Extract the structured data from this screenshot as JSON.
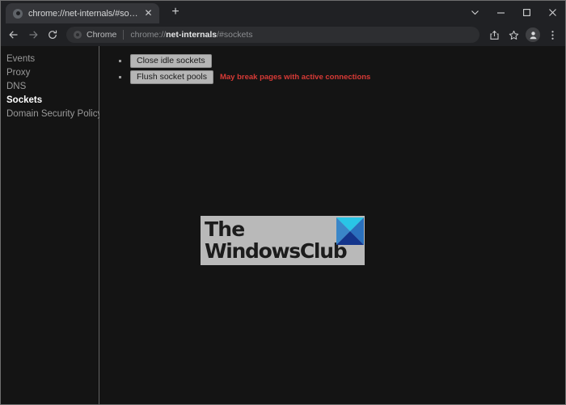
{
  "window": {
    "controls": [
      {
        "name": "tab-search",
        "glyph": "chevron-down"
      },
      {
        "name": "minimize",
        "glyph": "minimize"
      },
      {
        "name": "maximize",
        "glyph": "maximize"
      },
      {
        "name": "close",
        "glyph": "close"
      }
    ]
  },
  "tabstrip": {
    "tab_title": "chrome://net-internals/#sockets",
    "close_label": "✕",
    "new_tab_label": "+"
  },
  "toolbar": {
    "back_label": "Back",
    "forward_label": "Forward",
    "reload_label": "Reload",
    "omnibox": {
      "chip_label": "Chrome",
      "url_scheme": "chrome://",
      "url_host": "net-internals",
      "url_path": "/#sockets"
    },
    "share_label": "Share",
    "bookmark_label": "Bookmark this tab",
    "profile_label": "Profile",
    "menu_label": "Customize and control Google Chrome"
  },
  "sidebar": {
    "items": [
      {
        "label": "Events",
        "active": false
      },
      {
        "label": "Proxy",
        "active": false
      },
      {
        "label": "DNS",
        "active": false
      },
      {
        "label": "Sockets",
        "active": true
      },
      {
        "label": "Domain Security Policy",
        "active": false
      }
    ]
  },
  "main": {
    "actions": [
      {
        "button": "Close idle sockets",
        "warning": ""
      },
      {
        "button": "Flush socket pools",
        "warning": "May break pages with active connections"
      }
    ]
  },
  "watermark": {
    "line1": "The",
    "line2": "WindowsClub",
    "logo_name": "windowsclub-diamond-logo"
  },
  "colors": {
    "chrome_frame": "#202124",
    "tab_active": "#35363a",
    "page_background": "#141414",
    "sidebar_text": "#9a9a9a",
    "active_text": "#ffffff",
    "warning_red": "#d83a36",
    "button_face": "#b5b5b5",
    "watermark_background": "#b9b9b9",
    "logo_cyan": "#29c5e6",
    "logo_blue": "#2f7fc9",
    "logo_navy": "#1b3f8f"
  }
}
